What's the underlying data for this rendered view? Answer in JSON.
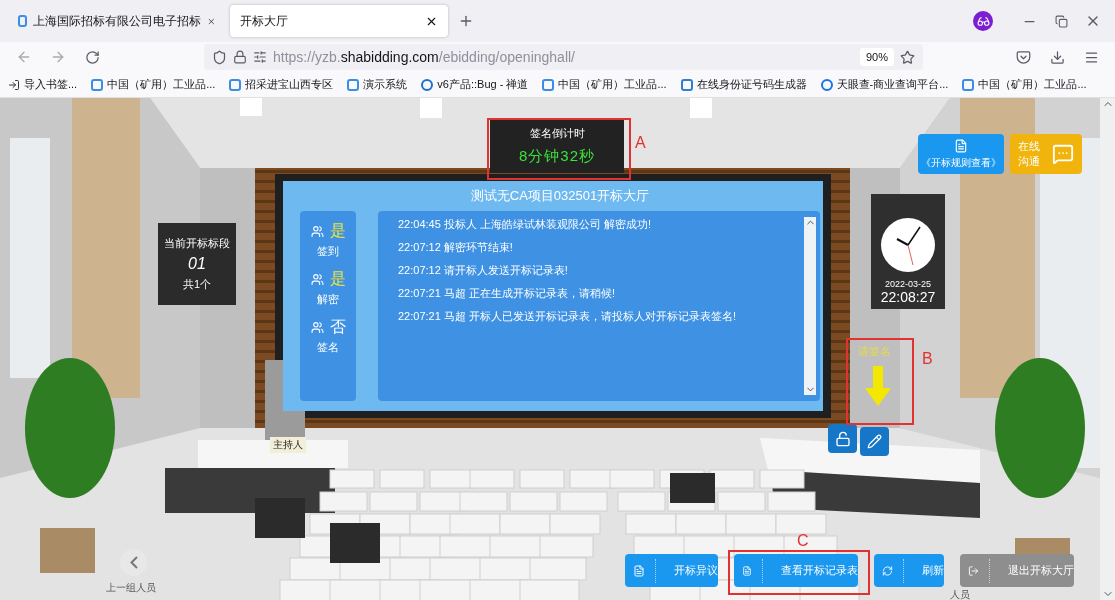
{
  "browser": {
    "tabs": [
      {
        "title": "上海国际招标有限公司电子招标",
        "selected": false
      },
      {
        "title": "开标大厅",
        "selected": true
      }
    ],
    "url": "https://yzb.**shabidding.com**/ebidding/openinghall/",
    "zoom": "90%",
    "bookmarks": [
      {
        "kind": "import",
        "label": "导入书签..."
      },
      {
        "kind": "site",
        "label": "中国（矿用）工业品..."
      },
      {
        "kind": "site",
        "label": "招采进宝山西专区"
      },
      {
        "kind": "site",
        "label": "演示系统"
      },
      {
        "kind": "bug",
        "label": "v6产品::Bug - 禅道"
      },
      {
        "kind": "site",
        "label": "中国（矿用）工业品..."
      },
      {
        "kind": "id",
        "label": "在线身份证号码生成器"
      },
      {
        "kind": "search",
        "label": "天眼查-商业查询平台..."
      },
      {
        "kind": "site",
        "label": "中国（矿用）工业品..."
      }
    ]
  },
  "hall": {
    "countdown": {
      "title": "签名倒计时",
      "value": "8分钟32秒"
    },
    "screen_title": "测试无CA项目032501开标大厅",
    "status": [
      {
        "value": "是",
        "label": "签到",
        "done": true
      },
      {
        "value": "是",
        "label": "解密",
        "done": true
      },
      {
        "value": "否",
        "label": "签名",
        "done": false
      }
    ],
    "log": [
      "22:04:45 投标人 上海皓绿试林装观限公司 解密成功!",
      "22:07:12 解密环节结束!",
      "22:07:12 请开标人发送开标记录表!",
      "22:07:21 马超 正在生成开标记录表，请稍候!",
      "22:07:21 马超 开标人已发送开标记录表，请投标人对开标记录表签名!"
    ],
    "section_board": {
      "title": "当前开标标段",
      "number": "01",
      "total": "共1个"
    },
    "clock": {
      "date": "2022-03-25",
      "time": "22:08:27"
    },
    "rules_button": "《开标规则查看》",
    "chat_button": [
      "在线",
      "沟通"
    ],
    "sign_hint": "请签名",
    "host_label": "主持人",
    "prev_group": "上一组人员",
    "next_group": "人员",
    "actions": [
      {
        "kind": "doc",
        "label": "开标异议"
      },
      {
        "kind": "doc",
        "label": "查看开标记录表"
      },
      {
        "kind": "refresh",
        "label": "刷新"
      },
      {
        "kind": "exit",
        "label": "退出开标大厅"
      }
    ],
    "annotations": [
      {
        "label": "A"
      },
      {
        "label": "B"
      },
      {
        "label": "C"
      }
    ]
  }
}
